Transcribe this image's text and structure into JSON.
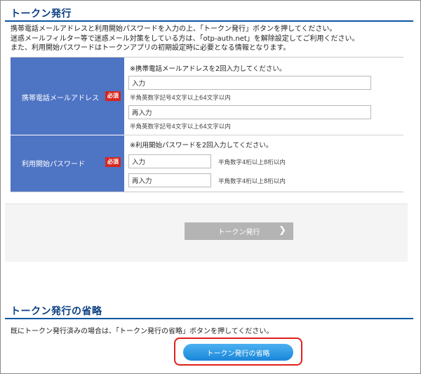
{
  "token_issue": {
    "title": "トークン発行",
    "intro": [
      "携帯電話メールアドレスと利用開始パスワードを入力の上、「トークン発行」ボタンを押してください。",
      "迷惑メールフィルター等で迷惑メール対策をしている方は、「otp-auth.net」を解除設定してご利用ください。",
      "また、利用開始パスワードはトークンアプリの初期設定時に必要となる情報となります。"
    ],
    "email_row": {
      "label": "携帯電話メールアドレス",
      "required_badge": "必須",
      "note": "※携帯電話メールアドレスを2回入力してください。",
      "input_1": {
        "value": "入力",
        "hint": "半角英数字記号4文字以上64文字以内"
      },
      "input_2": {
        "value": "再入力",
        "hint": "半角英数字記号4文字以上64文字以内"
      }
    },
    "password_row": {
      "label": "利用開始パスワード",
      "required_badge": "必須",
      "note": "※利用開始パスワードを2回入力してください。",
      "input_1": {
        "value": "入力",
        "hint": "半角数字4桁以上8桁以内"
      },
      "input_2": {
        "value": "再入力",
        "hint": "半角数字4桁以上8桁以内"
      }
    },
    "issue_button_label": "トークン発行",
    "issue_button_icon": "chevron-right-icon"
  },
  "skip_section": {
    "title": "トークン発行の省略",
    "intro": "既にトークン発行済みの場合は、「トークン発行の省略」ボタンを押してください。",
    "skip_button_label": "トークン発行の省略"
  },
  "colors": {
    "title": "#0b3f82",
    "label_cell": "#4e74c4",
    "required_badge": "#d6271f",
    "primary_button": "#1a86d8",
    "disabled_button": "#b4b4b4",
    "highlight": "#e0201a"
  }
}
